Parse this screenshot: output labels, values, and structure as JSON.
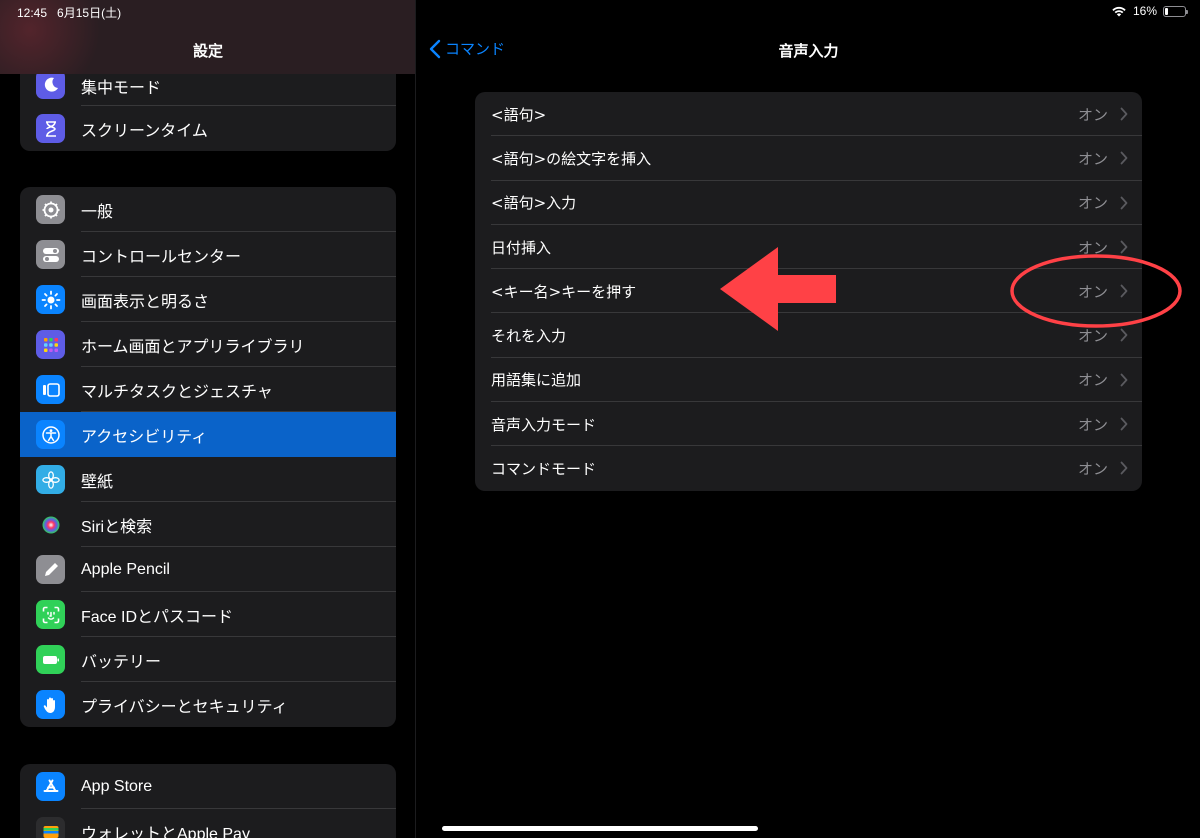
{
  "status": {
    "time": "12:45",
    "date": "6月15日(土)",
    "battery": "16%"
  },
  "sidebar": {
    "title": "設定",
    "group1": [
      {
        "label": "集中モード",
        "icon": "moon-icon",
        "color": "#5e5ce6"
      },
      {
        "label": "スクリーンタイム",
        "icon": "hourglass-icon",
        "color": "#5e5ce6"
      }
    ],
    "group2": [
      {
        "label": "一般",
        "icon": "gear-icon",
        "color": "#8e8e93"
      },
      {
        "label": "コントロールセンター",
        "icon": "toggles-icon",
        "color": "#8e8e93"
      },
      {
        "label": "画面表示と明るさ",
        "icon": "sun-icon",
        "color": "#0a84ff"
      },
      {
        "label": "ホーム画面とアプリライブラリ",
        "icon": "app-grid-icon",
        "color": "#5e5ce6"
      },
      {
        "label": "マルチタスクとジェスチャ",
        "icon": "multitask-icon",
        "color": "#0a84ff"
      },
      {
        "label": "アクセシビリティ",
        "icon": "accessibility-icon",
        "color": "#0a84ff"
      },
      {
        "label": "壁紙",
        "icon": "flower-icon",
        "color": "#32ade6"
      },
      {
        "label": "Siriと検索",
        "icon": "siri-icon",
        "color": "#1c1c1e"
      },
      {
        "label": "Apple Pencil",
        "icon": "pencil-icon",
        "color": "#8e8e93"
      },
      {
        "label": "Face IDとパスコード",
        "icon": "face-id-icon",
        "color": "#30d158"
      },
      {
        "label": "バッテリー",
        "icon": "battery-icon",
        "color": "#30d158"
      },
      {
        "label": "プライバシーとセキュリティ",
        "icon": "hand-icon",
        "color": "#0a84ff"
      }
    ],
    "group3": [
      {
        "label": "App Store",
        "icon": "app-store-icon",
        "color": "#0a84ff"
      },
      {
        "label": "ウォレットとApple Pay",
        "icon": "wallet-icon",
        "color": "#2c2c2e"
      }
    ]
  },
  "main": {
    "back_label": "コマンド",
    "title": "音声入力",
    "rows": [
      {
        "label": "<語句>",
        "value": "オン"
      },
      {
        "label": "<語句>の絵文字を挿入",
        "value": "オン"
      },
      {
        "label": "<語句>入力",
        "value": "オン"
      },
      {
        "label": "日付挿入",
        "value": "オン"
      },
      {
        "label": "<キー名>キーを押す",
        "value": "オン"
      },
      {
        "label": "それを入力",
        "value": "オン"
      },
      {
        "label": "用語集に追加",
        "value": "オン"
      },
      {
        "label": "音声入力モード",
        "value": "オン"
      },
      {
        "label": "コマンドモード",
        "value": "オン"
      }
    ]
  },
  "colors": {
    "accent": "#0a84ff",
    "selected": "#0a63c9",
    "annotation": "#ff4146"
  }
}
